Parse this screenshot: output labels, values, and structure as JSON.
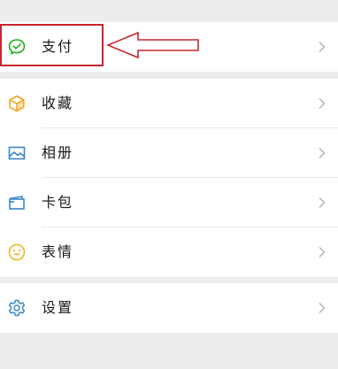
{
  "menu": {
    "pay": {
      "label": "支付",
      "icon": "wechat-pay-icon"
    },
    "favorites": {
      "label": "收藏",
      "icon": "cube-icon"
    },
    "album": {
      "label": "相册",
      "icon": "image-icon"
    },
    "cards": {
      "label": "卡包",
      "icon": "card-wallet-icon"
    },
    "stickers": {
      "label": "表情",
      "icon": "smiley-icon"
    },
    "settings": {
      "label": "设置",
      "icon": "gear-icon"
    }
  },
  "chevron_icon": "chevron-right-icon",
  "annotation": {
    "box_color": "#c9252e",
    "arrow_color": "#c9252e",
    "arrow_icon": "left-arrow-outline"
  },
  "colors": {
    "background": "#ededed",
    "row_background": "#ffffff",
    "pay_green": "#1aad19",
    "favorites_orange": "#f5a623",
    "blue_icons": "#3a86c8",
    "sticker_yellow": "#f0b51e",
    "text": "#1a1a1a",
    "chevron": "#b2b2b2"
  }
}
